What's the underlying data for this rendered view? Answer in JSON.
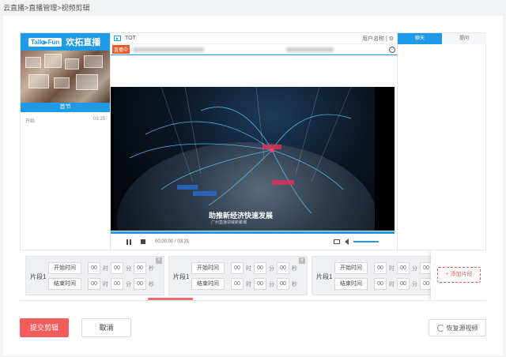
{
  "breadcrumb": "云直播>直播管理>视频剪辑",
  "left_panel": {
    "logo_text": "Talk▶Fun",
    "logo_cn": "欢拓直播",
    "thumb_caption": "首节",
    "row_label": "开始",
    "row_time": "03:25"
  },
  "player": {
    "title": "TOT",
    "top_right": "用户名称 | ⚙",
    "live_tag": "直播中",
    "caption": "助推新经济快速发展",
    "caption_sub": "广州直播领域新聚潮",
    "time": "00:00:00 / 03:31"
  },
  "chat_tabs": [
    "聊天",
    "提问"
  ],
  "segments": [
    {
      "name": "片段1",
      "start_label": "开始时间",
      "end_label": "结束时间",
      "start": [
        "00",
        "00",
        "00"
      ],
      "end": [
        "00",
        "00",
        "00"
      ]
    },
    {
      "name": "片段1",
      "start_label": "开始时间",
      "end_label": "结束时间",
      "start": [
        "00",
        "00",
        "00"
      ],
      "end": [
        "00",
        "00",
        "00"
      ]
    },
    {
      "name": "片段1",
      "start_label": "开始时间",
      "end_label": "结束时间",
      "start": [
        "00",
        "00",
        "00"
      ],
      "end": [
        "00",
        "00",
        "00"
      ]
    }
  ],
  "units": {
    "h": "时",
    "m": "分",
    "s": "秒"
  },
  "add_segment": "+ 添加片段",
  "submit": "提交剪辑",
  "cancel": "取消",
  "restore": "恢复源视频"
}
